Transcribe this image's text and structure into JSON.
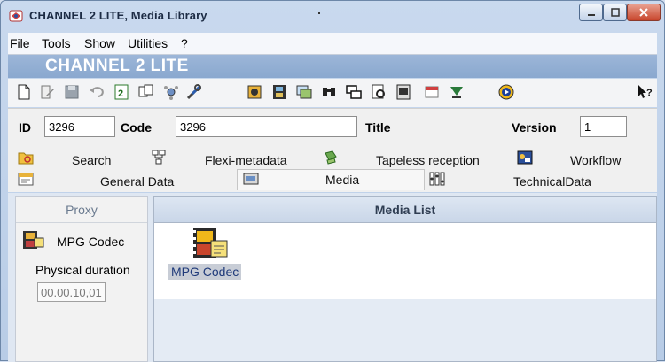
{
  "window": {
    "title": "CHANNEL 2 LITE, Media Library",
    "controls": [
      "minimize",
      "maximize",
      "close"
    ]
  },
  "menu": {
    "items": [
      "File",
      "Tools",
      "Show",
      "Utilities",
      "?"
    ]
  },
  "banner": {
    "text": "CHANNEL 2 LITE"
  },
  "toolbar": {
    "icons": [
      "new-icon",
      "edit-icon",
      "save-icon",
      "undo-icon",
      "excel-icon",
      "copy-icon",
      "network-icon",
      "tools-icon",
      "film-icon",
      "filmstrip-icon",
      "media-icon",
      "binoculars-icon",
      "windows-icon",
      "preview-icon",
      "report-icon",
      "calendar-icon",
      "download-icon",
      "play-icon",
      "help-pointer-icon"
    ]
  },
  "fields": {
    "id_label": "ID",
    "id_value": "3296",
    "code_label": "Code",
    "code_value": "3296",
    "title_label": "Title",
    "title_value": "",
    "version_label": "Version",
    "version_value": "1"
  },
  "tabs": {
    "row1": [
      {
        "label": "Search",
        "icon": "search-icon"
      },
      {
        "label": "Flexi-metadata",
        "icon": "flexi-metadata-icon"
      },
      {
        "label": "Tapeless reception",
        "icon": "tapeless-icon"
      },
      {
        "label": "Workflow",
        "icon": "workflow-icon"
      }
    ],
    "row2": [
      {
        "label": "General Data",
        "icon": "general-data-icon"
      },
      {
        "label": "Media",
        "icon": "media-tab-icon"
      },
      {
        "label": "TechnicalData",
        "icon": "technical-data-icon"
      }
    ],
    "active": "Media"
  },
  "proxy": {
    "title": "Proxy",
    "codec_label": "MPG Codec",
    "physical_duration_label": "Physical duration",
    "physical_duration_value": "00.00.10,01"
  },
  "media_list": {
    "header": "Media List",
    "items": [
      {
        "label": "MPG Codec",
        "icon": "mpg-codec-icon"
      }
    ]
  },
  "colors": {
    "banner": "#8aa8cf",
    "window_bg": "#c9d9ee",
    "close_button": "#c8452c"
  }
}
